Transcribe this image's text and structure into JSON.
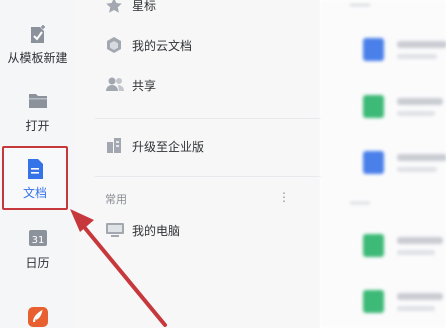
{
  "rail": {
    "items": [
      {
        "label": "从模板新建",
        "icon": "template-new-icon"
      },
      {
        "label": "打开",
        "icon": "folder-open-icon"
      },
      {
        "label": "文档",
        "icon": "document-icon"
      },
      {
        "label": "日历",
        "icon": "calendar-icon"
      }
    ]
  },
  "panel": {
    "items": [
      {
        "label": "星标",
        "icon": "star-icon"
      },
      {
        "label": "我的云文档",
        "icon": "cloud-doc-icon"
      },
      {
        "label": "共享",
        "icon": "share-people-icon"
      },
      {
        "label": "升级至企业版",
        "icon": "enterprise-icon"
      }
    ],
    "section": {
      "title": "常用",
      "more": "⋮"
    },
    "section_items": [
      {
        "label": "我的电脑",
        "icon": "computer-icon"
      }
    ]
  },
  "colors": {
    "accent": "#3573e9",
    "highlight_border": "#c6383b",
    "arrow": "#c6383b",
    "green_file": "#3dba77",
    "blue_file": "#4a80ea"
  }
}
